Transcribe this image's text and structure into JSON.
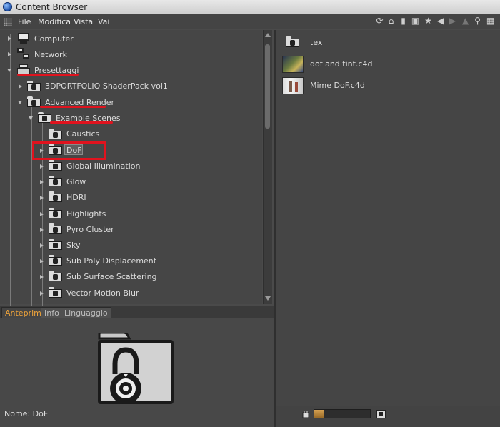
{
  "window": {
    "title": "Content Browser"
  },
  "menu": {
    "items": [
      "File",
      "Modifica",
      "Vista",
      "Vai"
    ]
  },
  "toolbar": {
    "icons": [
      "refresh-icon",
      "home-icon",
      "trash-icon",
      "save-icon",
      "star-icon",
      "back-icon",
      "forward-icon",
      "up-icon",
      "search-icon",
      "grid-view-icon"
    ]
  },
  "tree": {
    "items": [
      {
        "label": "Computer",
        "icon": "computer-icon"
      },
      {
        "label": "Network",
        "icon": "network-icon"
      },
      {
        "label": "Presettaggi",
        "icon": "presets-icon"
      },
      {
        "label": "3DPORTFOLIO ShaderPack vol1",
        "icon": "folder-lock-icon"
      },
      {
        "label": "Advanced Render",
        "icon": "folder-lock-icon"
      },
      {
        "label": "Example Scenes",
        "icon": "folder-lock-icon"
      },
      {
        "label": "Caustics",
        "icon": "folder-lock-icon"
      },
      {
        "label": "DoF",
        "icon": "folder-lock-icon",
        "selected": true
      },
      {
        "label": "Global Illumination",
        "icon": "folder-lock-icon"
      },
      {
        "label": "Glow",
        "icon": "folder-lock-icon"
      },
      {
        "label": "HDRI",
        "icon": "folder-lock-icon"
      },
      {
        "label": "Highlights",
        "icon": "folder-lock-icon"
      },
      {
        "label": "Pyro Cluster",
        "icon": "folder-lock-icon"
      },
      {
        "label": "Sky",
        "icon": "folder-lock-icon"
      },
      {
        "label": "Sub Poly Displacement",
        "icon": "folder-lock-icon"
      },
      {
        "label": "Sub Surface Scattering",
        "icon": "folder-lock-icon"
      },
      {
        "label": "Vector Motion Blur",
        "icon": "folder-lock-icon"
      }
    ]
  },
  "preview": {
    "tabs": [
      "Anteprima",
      "Info",
      "Linguaggio"
    ],
    "active_tab": "Anteprima",
    "name_label": "Nome:",
    "name_value": "DoF"
  },
  "content": {
    "items": [
      {
        "label": "tex",
        "type": "folder"
      },
      {
        "label": "dof and tint.c4d",
        "type": "scene"
      },
      {
        "label": "Mime DoF.c4d",
        "type": "scene"
      }
    ]
  },
  "zoom": {
    "level": 0.18
  },
  "colors": {
    "highlight_red": "#e0131e",
    "active_tab": "#f0a43a"
  }
}
